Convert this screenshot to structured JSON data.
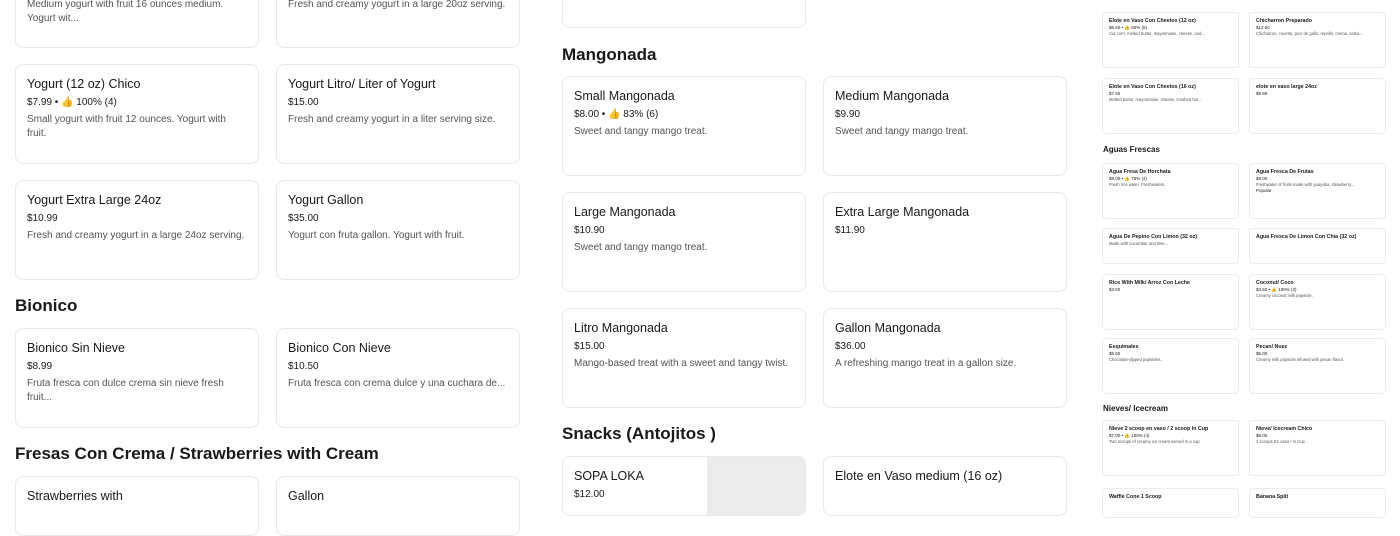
{
  "left": {
    "cards": [
      {
        "name": "",
        "meta": "",
        "desc": "Medium yogurt with fruit 16 ounces medium. Yogurt wit..."
      },
      {
        "name": "",
        "meta": "",
        "desc": "Fresh and creamy yogurt in a large 20oz serving."
      },
      {
        "name": "Yogurt (12 oz) Chico",
        "meta": "$7.99 • 👍 100% (4)",
        "desc": "Small yogurt with fruit 12 ounces. Yogurt with fruit."
      },
      {
        "name": "Yogurt Litro/ Liter of Yogurt",
        "meta": "$15.00",
        "desc": "Fresh and creamy yogurt in a liter serving size."
      },
      {
        "name": "Yogurt Extra Large 24oz",
        "meta": "$10.99",
        "desc": "Fresh and creamy yogurt in a large 24oz serving."
      },
      {
        "name": "Yogurt Gallon",
        "meta": "$35.00",
        "desc": "Yogurt con fruta gallon. Yogurt with fruit."
      },
      {
        "name": "Bionico Sin Nieve",
        "meta": "$8.99",
        "desc": "Fruta fresca con dulce crema sin nieve fresh fruit..."
      },
      {
        "name": "Bionico Con Nieve",
        "meta": "$10.50",
        "desc": "Fruta fresca con crema dulce y una cuchara de..."
      },
      {
        "name": "Strawberries with",
        "meta": "",
        "desc": ""
      },
      {
        "name": "Gallon",
        "meta": "",
        "desc": ""
      }
    ],
    "headings": {
      "bionico": "Bionico",
      "fresas": "Fresas Con Crema / Strawberries with Cream"
    }
  },
  "middle": {
    "headings": {
      "mangonada": "Mangonada",
      "snacks": "Snacks (Antojitos )"
    },
    "cards": [
      {
        "name": "Small Mangonada",
        "meta": "$8.00 • 👍 83% (6)",
        "desc": "Sweet and tangy mango treat."
      },
      {
        "name": "Medium Mangonada",
        "meta": "$9.90",
        "desc": "Sweet and tangy mango treat."
      },
      {
        "name": "Large Mangonada",
        "meta": "$10.90",
        "desc": "Sweet and tangy mango treat."
      },
      {
        "name": "Extra Large Mangonada",
        "meta": "$11.90",
        "desc": ""
      },
      {
        "name": "Litro Mangonada",
        "meta": "$15.00",
        "desc": "Mango-based treat with a sweet and tangy twist."
      },
      {
        "name": "Gallon Mangonada",
        "meta": "$36.00",
        "desc": "A refreshing mango treat in a gallon size."
      },
      {
        "name": "SOPA LOKA",
        "meta": "$12.00",
        "desc": ""
      },
      {
        "name": "Elote en Vaso medium (16 oz)",
        "meta": "",
        "desc": ""
      }
    ]
  },
  "right": {
    "headings": {
      "aguas": "Aguas Frescas",
      "nieves": "Nieves/ Icecream"
    },
    "cards": [
      {
        "name": "Elote en Vaso Con Cheetos (12 oz)",
        "meta": "$6.60 • 👍 60% (5)",
        "desc": "Cut corn, melted butter, mayonnaise, cheese, and...",
        "badge": ""
      },
      {
        "name": "Chicharron Preparado",
        "meta": "$12.50",
        "desc": "Chicharron, cueirito, pico de gallo, repollo, crema, salsa...",
        "badge": ""
      },
      {
        "name": "Elote en Vaso Con Cheetos (16 oz)",
        "meta": "$7.50",
        "desc": "Melted butter, mayonnaise, cheese, crushed hot...",
        "badge": ""
      },
      {
        "name": "elote en vaso large 24oz",
        "meta": "$9.99",
        "desc": "",
        "badge": ""
      },
      {
        "name": "Agua Fresa De Horchata",
        "meta": "$9.00 • 👍 75% (4)",
        "desc": "Fresh rice water. Freshwaters.",
        "badge": ""
      },
      {
        "name": "Agua Fresca De Frutas",
        "meta": "$9.00",
        "desc": "Freshwater of fruits made with guayaba, strawberry...",
        "badge": "Popular"
      },
      {
        "name": "Agua De Pepino Con Limon (32 oz)",
        "meta": "",
        "desc": "Made with cucumber and lime...",
        "badge": ""
      },
      {
        "name": "Agua Fresca De Limon Con Chia (32 oz)",
        "meta": "",
        "desc": "",
        "badge": ""
      },
      {
        "name": "Rice With Milk/ Arroz Con Leche",
        "meta": "$3.50",
        "desc": "",
        "badge": ""
      },
      {
        "name": "Coconut/ Coco",
        "meta": "$3.50 • 👍 100% (3)",
        "desc": "Creamy coconut milk popsicle.",
        "badge": ""
      },
      {
        "name": "Esquimales",
        "meta": "$5.50",
        "desc": "Chocolate-dipped popsicles.",
        "badge": ""
      },
      {
        "name": "Pecan/ Nuez",
        "meta": "$5.00",
        "desc": "Creamy milk popsicle infused with pecan flavor.",
        "badge": ""
      },
      {
        "name": "Nieve 2 scoop en vaso / 2 scoop In Cup",
        "meta": "$7.00 • 👍 100% (4)",
        "desc": "Two scoops of creamy ice cream served in a cup.",
        "badge": ""
      },
      {
        "name": "Nieve/ Icecream Chico",
        "meta": "$8.00",
        "desc": "3 scoops En vaso / In Cup",
        "badge": ""
      },
      {
        "name": "Waffle Cone 1 Scoop",
        "meta": "",
        "desc": "",
        "badge": ""
      },
      {
        "name": "Banana Split",
        "meta": "",
        "desc": "",
        "badge": ""
      }
    ]
  }
}
